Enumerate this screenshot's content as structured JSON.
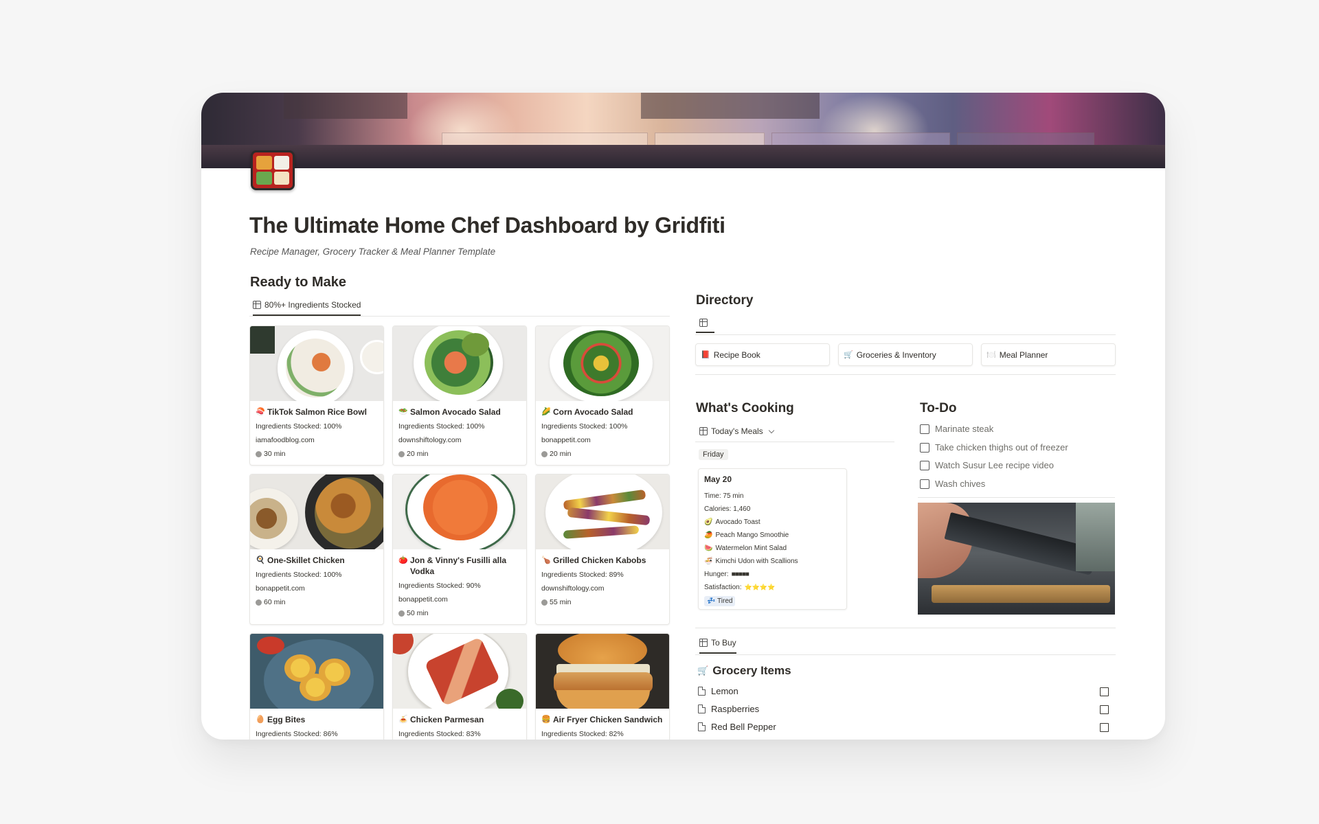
{
  "page": {
    "title": "The Ultimate Home Chef Dashboard by Gridfiti",
    "subtitle": "Recipe Manager, Grocery Tracker & Meal Planner Template"
  },
  "ready_to_make": {
    "heading": "Ready to Make",
    "view_tab": "80%+ Ingredients Stocked",
    "recipes": [
      {
        "name": "TikTok Salmon Rice Bowl",
        "emoji": "🍣",
        "stocked": "Ingredients Stocked: 100%",
        "source": "iamafoodblog.com",
        "time": "30 min"
      },
      {
        "name": "Salmon Avocado Salad",
        "emoji": "🥗",
        "stocked": "Ingredients Stocked: 100%",
        "source": "downshiftology.com",
        "time": "20 min"
      },
      {
        "name": "Corn Avocado Salad",
        "emoji": "🌽",
        "stocked": "Ingredients Stocked: 100%",
        "source": "bonappetit.com",
        "time": "20 min"
      },
      {
        "name": "One-Skillet Chicken",
        "emoji": "🍳",
        "stocked": "Ingredients Stocked: 100%",
        "source": "bonappetit.com",
        "time": "60 min"
      },
      {
        "name": "Jon & Vinny's Fusilli alla Vodka",
        "emoji": "🍅",
        "stocked": "Ingredients Stocked: 90%",
        "source": "bonappetit.com",
        "time": "50 min"
      },
      {
        "name": "Grilled Chicken Kabobs",
        "emoji": "🍗",
        "stocked": "Ingredients Stocked: 89%",
        "source": "downshiftology.com",
        "time": "55 min"
      },
      {
        "name": "Egg Bites",
        "emoji": "🥚",
        "stocked": "Ingredients Stocked: 86%",
        "source": "",
        "time": ""
      },
      {
        "name": "Chicken Parmesan",
        "emoji": "🍝",
        "stocked": "Ingredients Stocked: 83%",
        "source": "",
        "time": ""
      },
      {
        "name": "Air Fryer Chicken Sandwich",
        "emoji": "🍔",
        "stocked": "Ingredients Stocked: 82%",
        "source": "",
        "time": ""
      }
    ]
  },
  "directory": {
    "heading": "Directory",
    "items": [
      {
        "label": "Recipe Book",
        "emoji": "📕"
      },
      {
        "label": "Groceries & Inventory",
        "emoji": "🛒"
      },
      {
        "label": "Meal Planner",
        "emoji": "🍽️"
      }
    ]
  },
  "whats_cooking": {
    "heading": "What's Cooking",
    "view_tab": "Today's Meals",
    "group": "Friday",
    "meal": {
      "date": "May 20",
      "time": "Time: 75 min",
      "calories": "Calories: 1,460",
      "dishes": [
        {
          "emoji": "🥑",
          "name": "Avocado Toast"
        },
        {
          "emoji": "🥭",
          "name": "Peach Mango Smoothie"
        },
        {
          "emoji": "🍉",
          "name": "Watermelon Mint Salad"
        },
        {
          "emoji": "🍜",
          "name": "Kimchi Udon with Scallions"
        }
      ],
      "hunger_label": "Hunger:",
      "hunger_value": "■■■■■",
      "satisfaction_label": "Satisfaction:",
      "satisfaction_value": "⭐⭐⭐⭐",
      "mood": "💤 Tired"
    }
  },
  "todo": {
    "heading": "To-Do",
    "items": [
      "Marinate steak",
      "Take chicken thighs out of freezer",
      "Watch Susur Lee recipe video",
      "Wash chives"
    ]
  },
  "to_buy": {
    "view_tab": "To Buy",
    "heading": "Grocery Items",
    "heading_emoji": "🛒",
    "items": [
      "Lemon",
      "Raspberries",
      "Red Bell Pepper"
    ]
  }
}
